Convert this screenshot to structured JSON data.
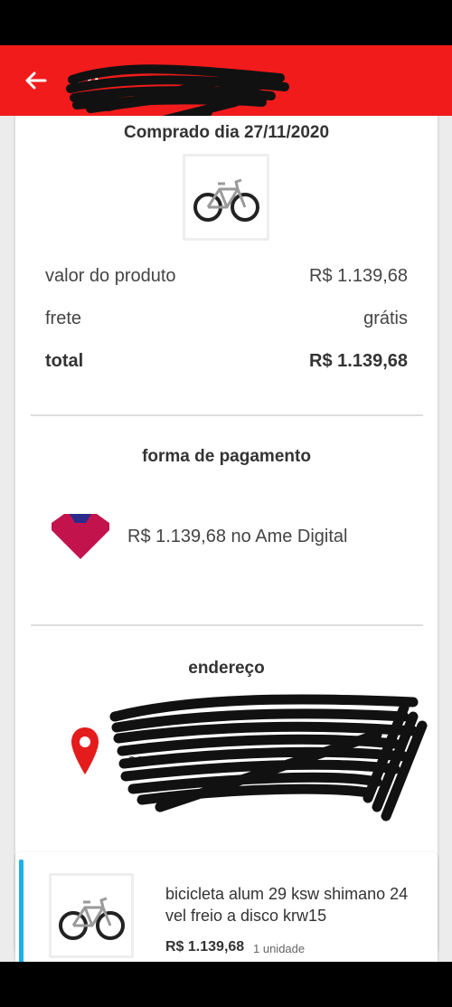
{
  "header": {
    "title": "co",
    "back_icon": "arrow-left-icon",
    "bg_color": "#f21b1b"
  },
  "order": {
    "purchase_date": "Comprado dia 27/11/2020",
    "product_value_label": "valor do produto",
    "product_value": "R$ 1.139,68",
    "shipping_label": "frete",
    "shipping_value": "grátis",
    "total_label": "total",
    "total_value": "R$ 1.139,68"
  },
  "payment": {
    "section_title": "forma de pagamento",
    "text": "R$ 1.139,68 no Ame Digital",
    "icon": "ame-digital-logo"
  },
  "address": {
    "section_title": "endereço",
    "icon": "location-pin-icon",
    "line1": "",
    "line2": "ce"
  },
  "item": {
    "title": "bicicleta alum 29 ksw shimano 24 vel freio a disco krw15",
    "price": "R$ 1.139,68",
    "quantity": "1 unidade",
    "accent_color": "#1eb1e8"
  }
}
